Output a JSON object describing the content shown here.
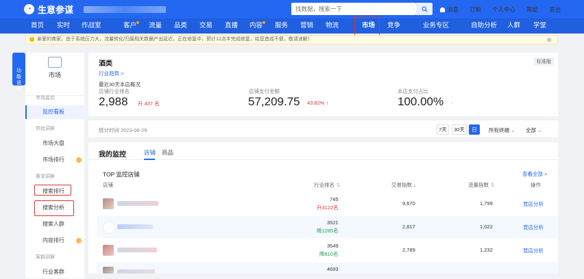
{
  "brand": {
    "name": "生意参谋"
  },
  "search": {
    "placeholder": "找数据，搜索一下"
  },
  "topbar": {
    "links": [
      "消息",
      "订购",
      "个人中心",
      "帮助",
      "退出"
    ]
  },
  "nav": {
    "items": [
      "首页",
      "实时",
      "作战室",
      "客户",
      "流量",
      "品类",
      "交易",
      "直播",
      "内容",
      "服务",
      "营销",
      "物流",
      "市场",
      "竞争",
      "业务专区",
      "自助分析",
      "人群",
      "学堂"
    ],
    "active": "市场"
  },
  "notice": {
    "text": "亲爱的商家，由于系统压力大，流量转化/归属相关数据产出延迟，正在修复中，预计12点半完成修复，给您造成不便，敬请谅解！"
  },
  "floating_help": {
    "label": "功能说明"
  },
  "sidebar": {
    "title": "市场",
    "sections": [
      {
        "title": "市场监控",
        "items": [
          "监控看板"
        ]
      },
      {
        "title": "供给洞察",
        "items": [
          "市场大盘",
          "市场排行"
        ]
      },
      {
        "title": "需求洞察",
        "items": [
          "搜索排行",
          "搜索分析",
          "搜索人群",
          "内容排行"
        ]
      },
      {
        "title": "客群洞察",
        "items": [
          "行业客群"
        ]
      }
    ],
    "active_item": "监控看板"
  },
  "overview": {
    "category": "酒类",
    "badge": "标准版",
    "trend_link": "行业趋势 >",
    "period": "最近30天本店概况",
    "metrics": [
      {
        "label": "店铺行业排名",
        "value": "2,988",
        "change": "升 437 名"
      },
      {
        "label": "店铺支付金额",
        "value": "57,209.75",
        "change": "43.82% ↑"
      },
      {
        "label": "本店支付占比",
        "value": "100.00%",
        "change": "-"
      }
    ]
  },
  "stats_bar": {
    "time": "统计时间 2023-06-29",
    "ranges": [
      "7天",
      "30天",
      "日"
    ],
    "active_range": "日",
    "terminal": "所有终端",
    "scope": "全部"
  },
  "monitor": {
    "title": "我的监控",
    "tabs": [
      "店铺",
      "商品"
    ],
    "active_tab": "店铺",
    "section_title": "TOP 监控店铺",
    "view_all": "查看全部 >",
    "columns": [
      "店铺",
      "行业排名",
      "交易指数",
      "流量指数",
      "操作"
    ],
    "rows": [
      {
        "rank": "745",
        "rank_change": "升3122名",
        "trade": "9,670",
        "traffic": "1,799",
        "action": "竞店分析"
      },
      {
        "rank": "3521",
        "rank_change": "降1285名",
        "trade": "2,817",
        "traffic": "1,022",
        "action": "竞店分析"
      },
      {
        "rank": "3549",
        "rank_change": "降810名",
        "trade": "2,789",
        "traffic": "1,232",
        "action": "竞店分析"
      },
      {
        "rank": "4693",
        "rank_change": "",
        "trade": "",
        "traffic": "",
        "action": ""
      }
    ]
  },
  "colors": {
    "primary": "#2468f2",
    "up": "#e0332f",
    "down": "#1aa052",
    "highlight_box": "#d9342b"
  }
}
